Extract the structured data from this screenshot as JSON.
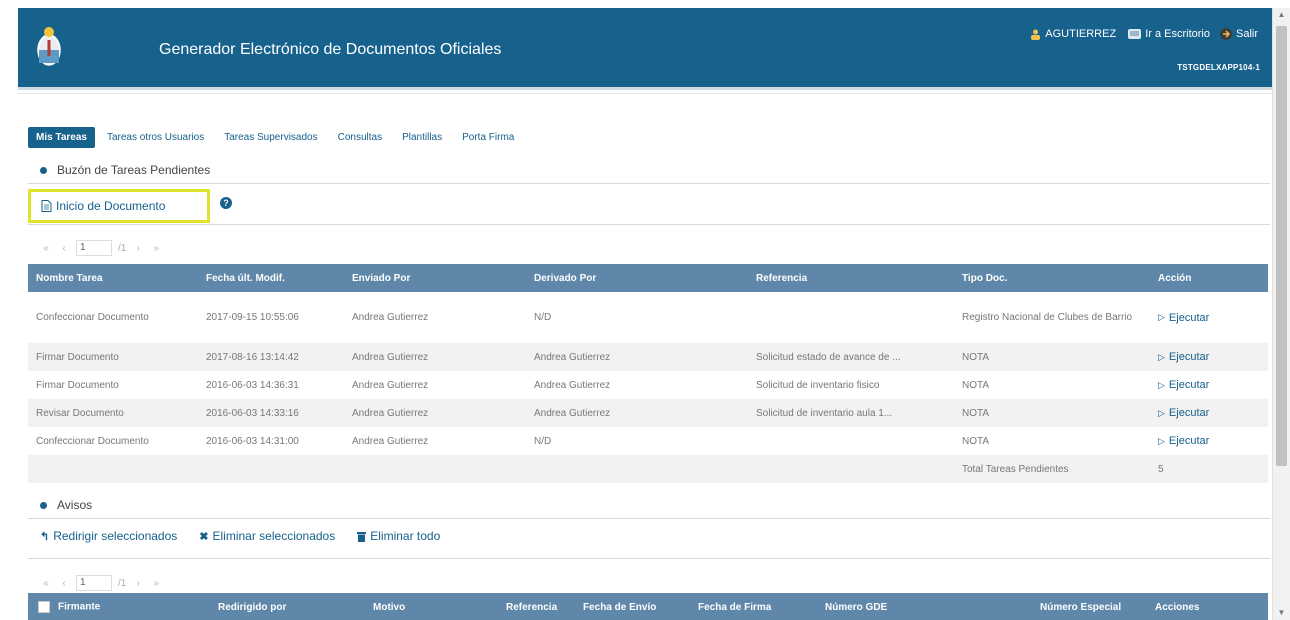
{
  "header": {
    "title": "Generador Electrónico de Documentos Oficiales",
    "user": "AGUTIERREZ",
    "escritorio": "Ir a Escritorio",
    "salir": "Salir",
    "server": "TSTGDELXAPP104-1"
  },
  "tabs": [
    {
      "label": "Mis Tareas",
      "active": true
    },
    {
      "label": "Tareas otros Usuarios",
      "active": false
    },
    {
      "label": "Tareas Supervisados",
      "active": false
    },
    {
      "label": "Consultas",
      "active": false
    },
    {
      "label": "Plantillas",
      "active": false
    },
    {
      "label": "Porta Firma",
      "active": false
    }
  ],
  "buzon": {
    "title": "Buzón de Tareas Pendientes",
    "inicio_label": "Inicio de Documento",
    "help": "?",
    "pager": {
      "first": "«",
      "prev": "‹",
      "page": "1",
      "total": "/1",
      "next": "›",
      "last": "»"
    },
    "columns": [
      "Nombre Tarea",
      "Fecha últ. Modif.",
      "Enviado Por",
      "Derivado Por",
      "Referencia",
      "Tipo Doc.",
      "Acción"
    ],
    "rows": [
      {
        "tarea": "Confeccionar Documento",
        "fecha": "2017-09-15 10:55:06",
        "enviado": "Andrea Gutierrez",
        "derivado": "N/D",
        "referencia": "",
        "tipo": "Registro Nacional de Clubes de Barrio",
        "accion": "Ejecutar"
      },
      {
        "tarea": "Firmar Documento",
        "fecha": "2017-08-16 13:14:42",
        "enviado": "Andrea Gutierrez",
        "derivado": "Andrea Gutierrez",
        "referencia": "Solicitud estado de avance de ...",
        "tipo": "NOTA",
        "accion": "Ejecutar"
      },
      {
        "tarea": "Firmar Documento",
        "fecha": "2016-06-03 14:36:31",
        "enviado": "Andrea Gutierrez",
        "derivado": "Andrea Gutierrez",
        "referencia": "Solicitud de inventario fisico",
        "tipo": "NOTA",
        "accion": "Ejecutar"
      },
      {
        "tarea": "Revisar Documento",
        "fecha": "2016-06-03 14:33:16",
        "enviado": "Andrea Gutierrez",
        "derivado": "Andrea Gutierrez",
        "referencia": "Solicitud de inventario aula 1...",
        "tipo": "NOTA",
        "accion": "Ejecutar"
      },
      {
        "tarea": "Confeccionar Documento",
        "fecha": "2016-06-03 14:31:00",
        "enviado": "Andrea Gutierrez",
        "derivado": "N/D",
        "referencia": "",
        "tipo": "NOTA",
        "accion": "Ejecutar"
      }
    ],
    "total_label": "Total Tareas Pendientes",
    "total_value": "5"
  },
  "avisos": {
    "title": "Avisos",
    "redirigir": "Redirigir seleccionados",
    "eliminar_sel": "Eliminar seleccionados",
    "eliminar_todo": "Eliminar todo",
    "pager": {
      "first": "«",
      "prev": "‹",
      "page": "1",
      "total": "/1",
      "next": "›",
      "last": "»"
    },
    "columns": [
      "Firmante",
      "Redirigido por",
      "Motivo",
      "Referencia",
      "Fecha de Envío",
      "Fecha de Firma",
      "Número GDE",
      "Número Especial",
      "Acciones"
    ]
  },
  "colors": {
    "header_bg": "#17618d",
    "table_header_bg": "#5e87a9",
    "highlight_border": "#e0e32c",
    "link": "#17618d"
  },
  "icons": {
    "user": "user-icon",
    "escritorio": "desktop-icon",
    "salir": "exit-icon",
    "document": "document-icon",
    "help": "help-icon",
    "execute": "play-arrow-icon",
    "redirect": "reply-icon",
    "delete": "x-icon",
    "trash": "trash-icon"
  }
}
